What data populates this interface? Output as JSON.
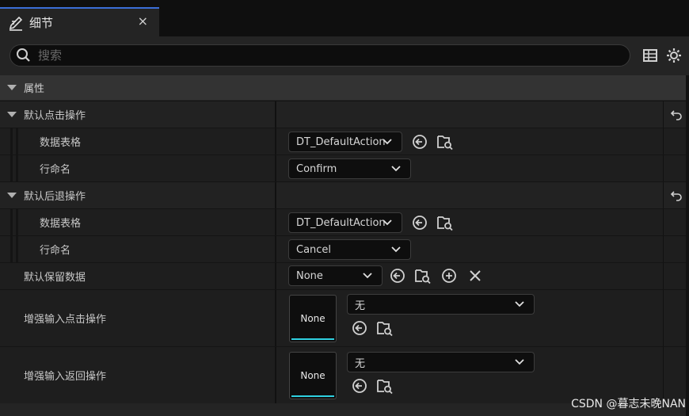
{
  "tab": {
    "title": "细节",
    "icon": "pencil-icon",
    "close": "×"
  },
  "search": {
    "placeholder": "搜索"
  },
  "section": {
    "title": "属性"
  },
  "groups": {
    "click": {
      "label": "默认点击操作",
      "table_label": "数据表格",
      "table_value": "DT_DefaultAction",
      "row_label": "行命名",
      "row_value": "Confirm"
    },
    "back": {
      "label": "默认后退操作",
      "table_label": "数据表格",
      "table_value": "DT_DefaultAction",
      "row_label": "行命名",
      "row_value": "Cancel"
    }
  },
  "persistent": {
    "label": "默认保留数据",
    "value": "None"
  },
  "enhanced_click": {
    "label": "增强输入点击操作",
    "thumb": "None",
    "value": "无"
  },
  "enhanced_back": {
    "label": "增强输入返回操作",
    "thumb": "None",
    "value": "无"
  },
  "watermark": "CSDN @暮志未晚NAN",
  "colors": {
    "accent_tab": "#3a6ed8",
    "thumb_underline": "#2fd0e0",
    "panel": "#242424"
  }
}
